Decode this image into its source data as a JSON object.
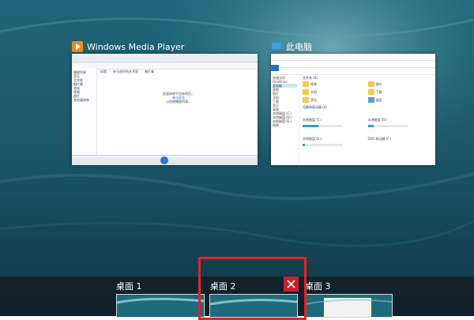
{
  "windows": [
    {
      "title": "Windows Media Player",
      "icon": "media-player-icon",
      "content": {
        "sidebar": [
          "播放列表",
          "音乐",
          "艺术家",
          "唱片集",
          "流派",
          "视频",
          "图片",
          "其他媒体库"
        ],
        "columns": [
          "标题",
          "参与创作的艺术家",
          "唱片集"
        ],
        "message": [
          "此媒体库中没有项目。",
          "单击此处",
          "以创建播放列表。"
        ]
      }
    },
    {
      "title": "此电脑",
      "icon": "computer-icon",
      "content": {
        "sections": [
          "文件夹 (6)",
          "设备和驱动器 (4)"
        ],
        "nav": [
          "快速访问",
          "OneDrive",
          "此电脑",
          "视频",
          "图片",
          "文档",
          "下载",
          "音乐",
          "桌面",
          "本地磁盘 (C:)",
          "本地磁盘 (D:)",
          "本地磁盘 (E:)",
          "网络"
        ],
        "folders": [
          "视频",
          "图片",
          "文档",
          "下载",
          "音乐",
          "桌面"
        ],
        "drives": [
          "本地磁盘 (C:)",
          "本地磁盘 (D:)",
          "本地磁盘 (E:)",
          "DVD 驱动器 (F:)"
        ]
      }
    }
  ],
  "desktops": [
    {
      "label": "桌面 1"
    },
    {
      "label": "桌面 2",
      "selected": true
    },
    {
      "label": "桌面 3"
    }
  ],
  "colors": {
    "highlight": "#e0232b",
    "close": "#c9202a",
    "ocean": "#1e5a6a"
  }
}
